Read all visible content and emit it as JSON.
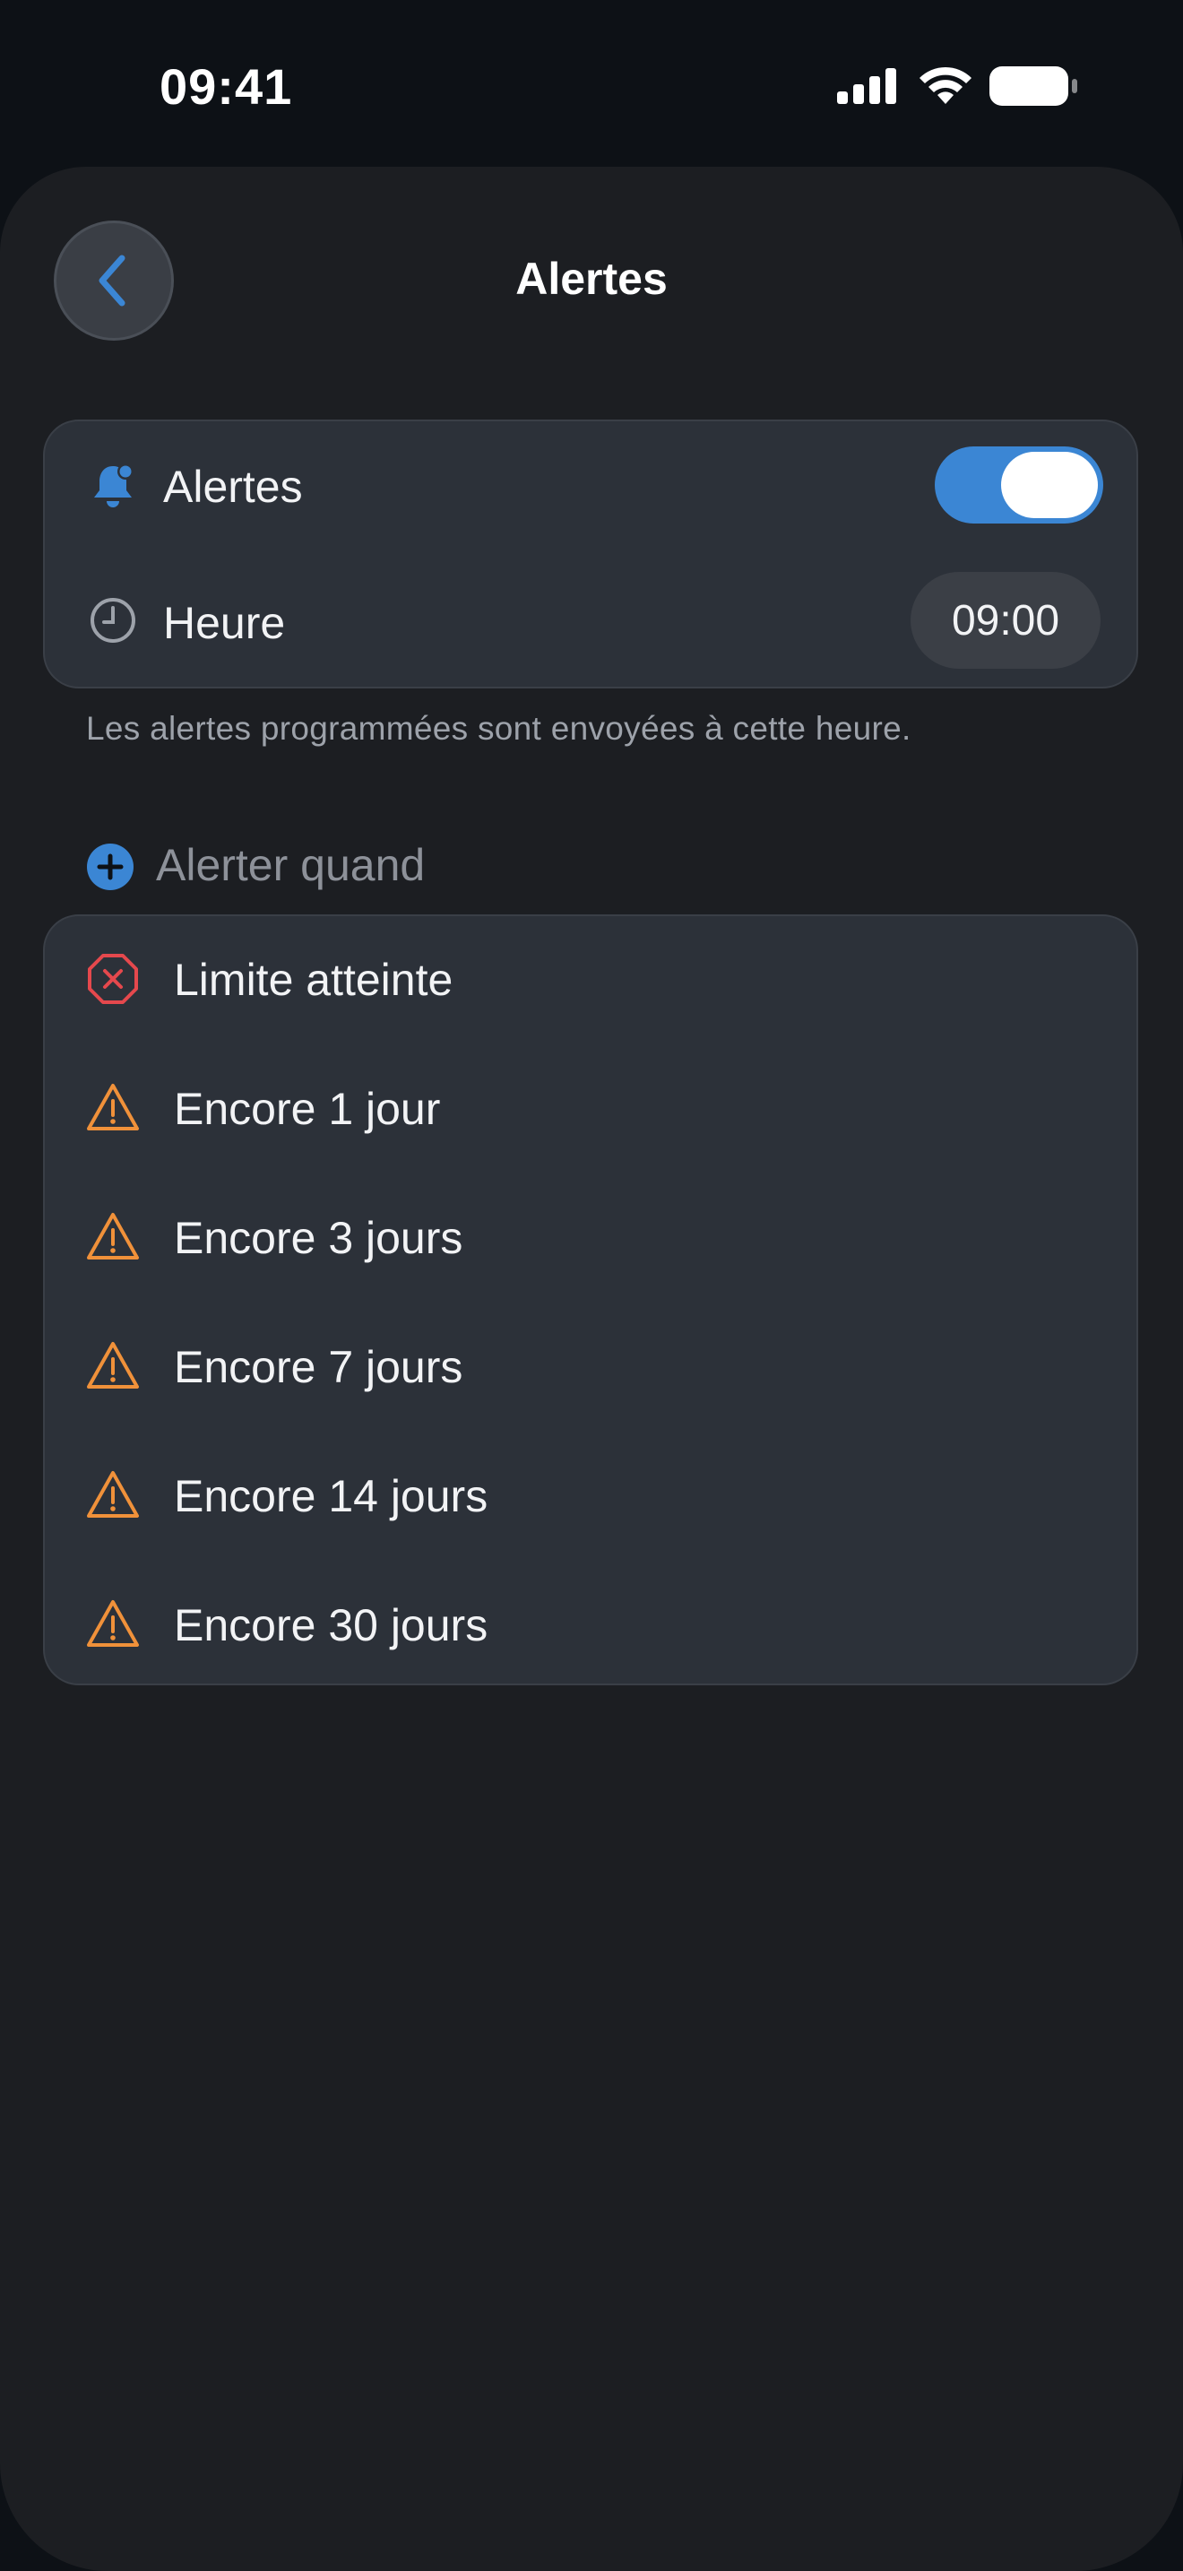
{
  "status_bar": {
    "time": "09:41",
    "icons": [
      "cellular-signal-icon",
      "wifi-icon",
      "battery-icon"
    ]
  },
  "nav": {
    "back_icon": "chevron-left-icon",
    "title": "Alertes"
  },
  "settings": {
    "alerts_label": "Alertes",
    "alerts_enabled": true,
    "time_label": "Heure",
    "time_value": "09:00",
    "footnote": "Les alertes programmées sont envoyées à cette heure."
  },
  "alert_when": {
    "title": "Alerter quand",
    "items": [
      {
        "label": "Limite atteinte",
        "icon": "x-octagon-icon",
        "color": "#e5484d"
      },
      {
        "label": "Encore 1 jour",
        "icon": "warning-triangle-icon",
        "color": "#f0913a"
      },
      {
        "label": "Encore 3 jours",
        "icon": "warning-triangle-icon",
        "color": "#f0913a"
      },
      {
        "label": "Encore 7 jours",
        "icon": "warning-triangle-icon",
        "color": "#f0913a"
      },
      {
        "label": "Encore 14 jours",
        "icon": "warning-triangle-icon",
        "color": "#f0913a"
      },
      {
        "label": "Encore 30 jours",
        "icon": "warning-triangle-icon",
        "color": "#f0913a"
      }
    ]
  },
  "colors": {
    "accent": "#3b86d4",
    "background": "#1c1e22",
    "card": "#2c3139",
    "danger": "#e5484d",
    "warning": "#f0913a"
  }
}
